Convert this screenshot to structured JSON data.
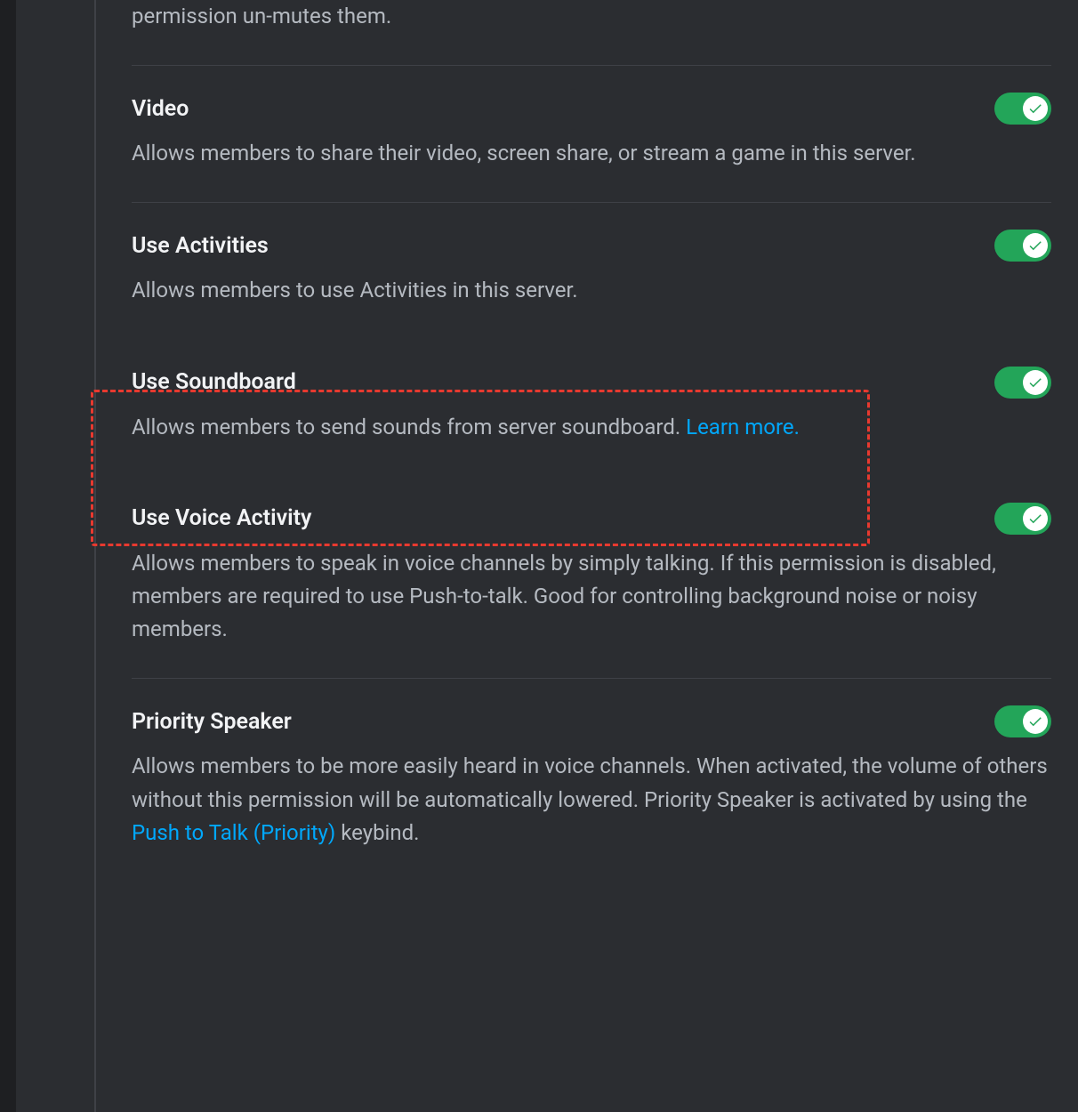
{
  "permissions": {
    "speak": {
      "desc_fragment": "permission un-mutes them."
    },
    "video": {
      "title": "Video",
      "desc": "Allows members to share their video, screen share, or stream a game in this server.",
      "enabled": true
    },
    "activities": {
      "title": "Use Activities",
      "desc": "Allows members to use Activities in this server.",
      "enabled": true
    },
    "soundboard": {
      "title": "Use Soundboard",
      "desc_prefix": "Allows members to send sounds from server soundboard. ",
      "link": "Learn more.",
      "enabled": true
    },
    "voice_activity": {
      "title": "Use Voice Activity",
      "desc": "Allows members to speak in voice channels by simply talking. If this permission is disabled, members are required to use Push-to-talk. Good for controlling background noise or noisy members.",
      "enabled": true
    },
    "priority_speaker": {
      "title": "Priority Speaker",
      "desc_prefix": "Allows members to be more easily heard in voice channels. When activated, the volume of others without this permission will be automatically lowered. Priority Speaker is activated by using the ",
      "link": "Push to Talk (Priority)",
      "desc_suffix": " keybind.",
      "enabled": true
    }
  }
}
